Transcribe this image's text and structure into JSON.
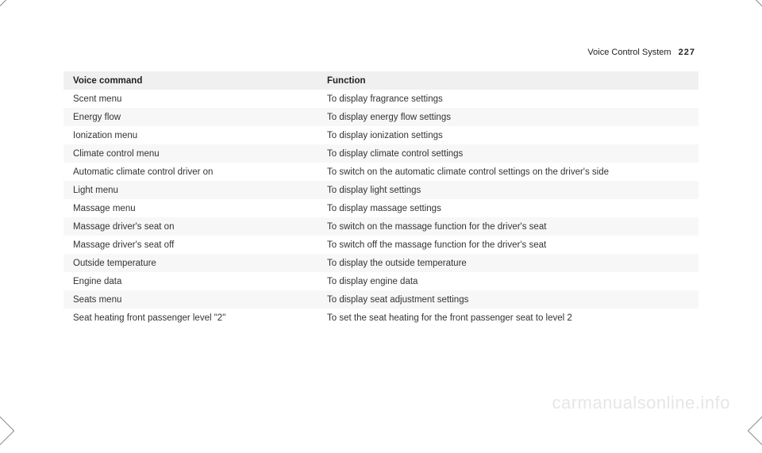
{
  "header": {
    "section_title": "Voice Control System",
    "page_number": "227"
  },
  "table": {
    "columns": {
      "command": "Voice command",
      "function": "Function"
    },
    "rows": [
      {
        "command": "Scent menu",
        "function": "To display fragrance settings"
      },
      {
        "command": "Energy flow",
        "function": "To display energy flow settings"
      },
      {
        "command": "Ionization menu",
        "function": "To display ionization settings"
      },
      {
        "command": "Climate control menu",
        "function": "To display climate control settings"
      },
      {
        "command": "Automatic climate control driver on",
        "function": "To switch on the automatic climate control settings on the driver's side"
      },
      {
        "command": "Light menu",
        "function": "To display light settings"
      },
      {
        "command": "Massage menu",
        "function": "To display massage settings"
      },
      {
        "command": "Massage driver's seat on",
        "function": "To switch on the massage function for the driver's seat"
      },
      {
        "command": "Massage driver's seat off",
        "function": "To switch off the massage function for the driver's seat"
      },
      {
        "command": "Outside temperature",
        "function": "To display the outside temperature"
      },
      {
        "command": "Engine data",
        "function": "To display engine data"
      },
      {
        "command": "Seats menu",
        "function": "To display seat adjustment settings"
      },
      {
        "command": "Seat heating front passenger level \"2\"",
        "function": "To set the seat heating for the front passenger seat to level 2"
      }
    ]
  },
  "watermark": "carmanualsonline.info"
}
